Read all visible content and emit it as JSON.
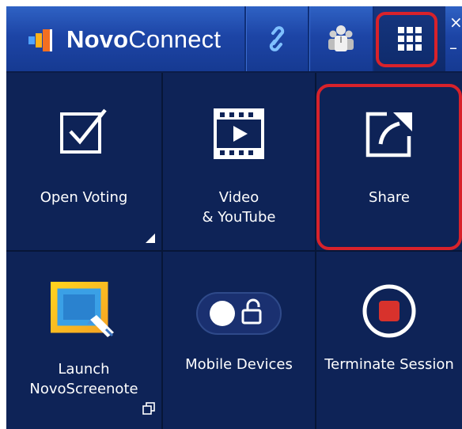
{
  "app": {
    "brand_bold": "Novo",
    "brand_rest": "Connect"
  },
  "titlebar": {
    "buttons": [
      {
        "icon": "link-icon"
      },
      {
        "icon": "participants-icon"
      },
      {
        "icon": "apps-grid-icon",
        "active": true
      }
    ],
    "window_controls": {
      "close": "×",
      "minimize": "–"
    }
  },
  "tiles": [
    {
      "id": "open-voting",
      "label": "Open Voting",
      "icon": "checkbox-icon",
      "has_submenu": true
    },
    {
      "id": "video-youtube",
      "label": "Video\n& YouTube",
      "icon": "video-play-icon"
    },
    {
      "id": "share",
      "label": "Share",
      "icon": "share-icon"
    },
    {
      "id": "launch-novoscreenote",
      "label": "Launch\nNovoScreenote",
      "icon": "screenote-icon",
      "has_external": true
    },
    {
      "id": "mobile-devices",
      "label": "Mobile Devices",
      "icon": "toggle-lock-icon"
    },
    {
      "id": "terminate-session",
      "label": "Terminate Session",
      "icon": "stop-icon"
    }
  ],
  "colors": {
    "background": "#0e2357",
    "titlebar": "#1d45a6",
    "highlight": "#d8222b",
    "stop_red": "#d8322c"
  }
}
